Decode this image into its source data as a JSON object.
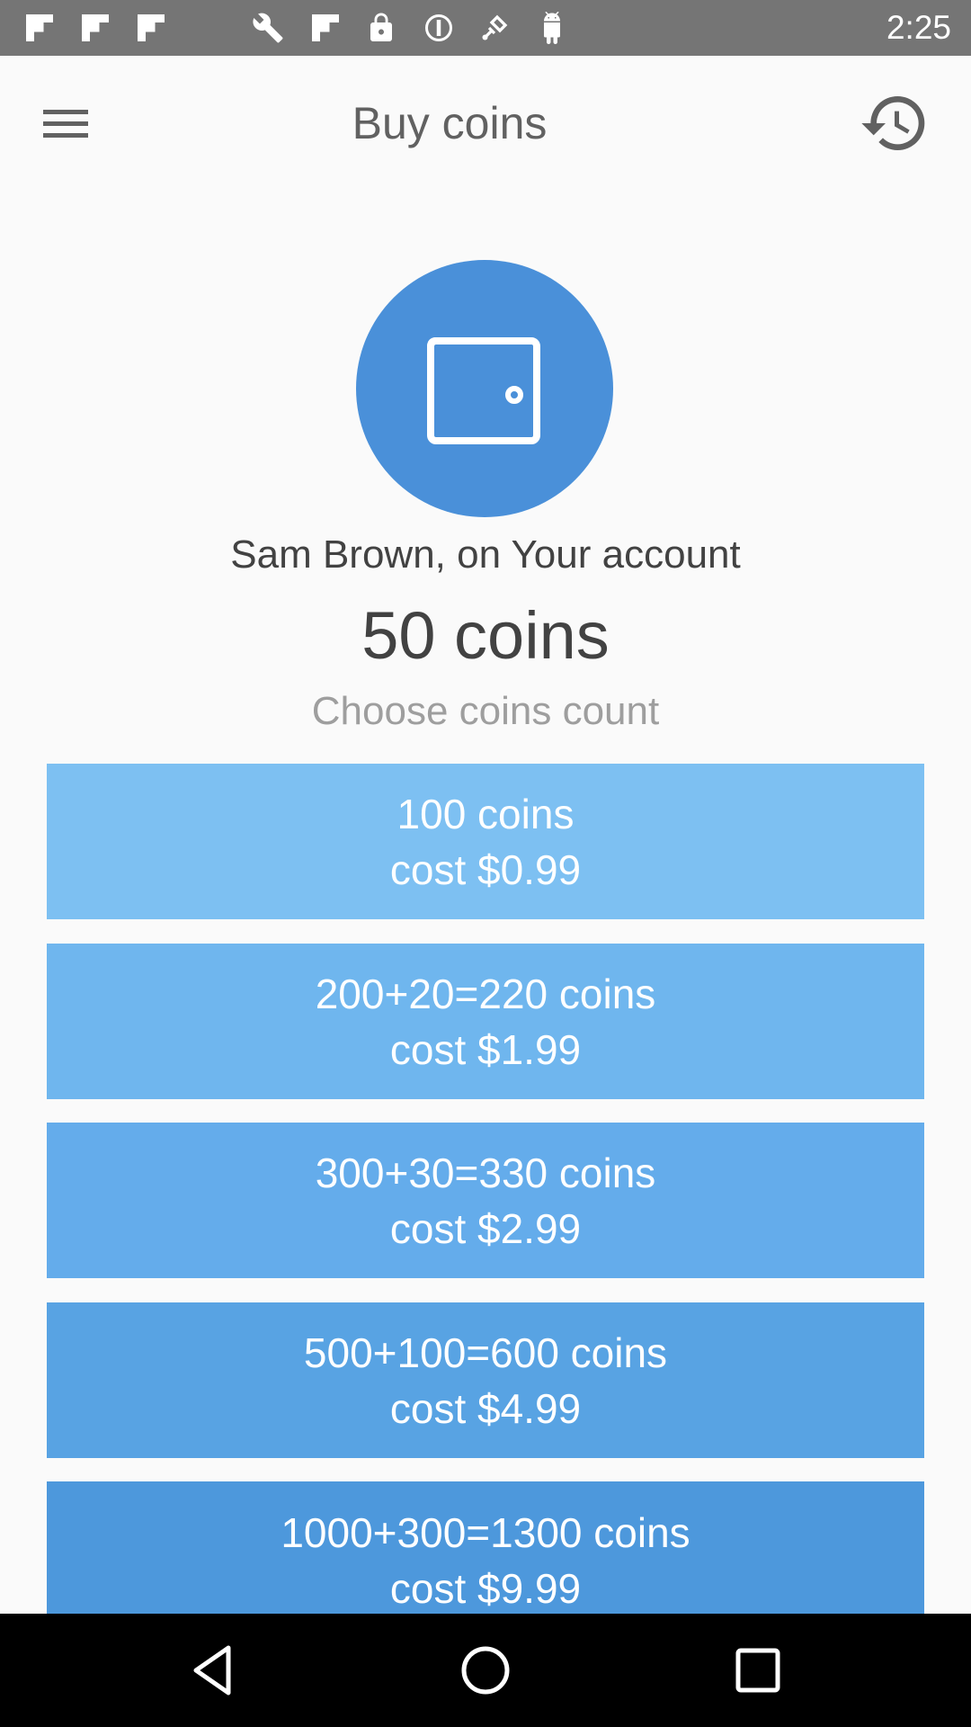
{
  "status_bar": {
    "time": "2:25",
    "icons": [
      "flipboard-icon",
      "flipboard-icon",
      "flipboard-icon",
      "wrench-icon",
      "flipboard-icon",
      "lock-icon",
      "sync-icon",
      "fake-gps-icon",
      "android-icon"
    ]
  },
  "app_bar": {
    "title": "Buy coins",
    "menu_icon": "menu-icon",
    "history_icon": "history-icon"
  },
  "account": {
    "wallet_icon": "wallet-icon",
    "line": "Sam Brown, on Your account",
    "balance": "50 coins",
    "choose_label": "Choose coins count"
  },
  "packages": [
    {
      "coins": "100 coins",
      "cost": "cost $0.99",
      "color": "#7dc0f2"
    },
    {
      "coins": "200+20=220 coins",
      "cost": "cost $1.99",
      "color": "#6fb6ee"
    },
    {
      "coins": "300+30=330 coins",
      "cost": "cost $2.99",
      "color": "#64aceb"
    },
    {
      "coins": "500+100=600 coins",
      "cost": "cost $4.99",
      "color": "#58a3e3"
    },
    {
      "coins": "1000+300=1300 coins",
      "cost": "cost $9.99",
      "color": "#4d98dc"
    }
  ],
  "nav_bar": {
    "back_icon": "back-icon",
    "home_icon": "home-icon",
    "recents_icon": "recents-icon"
  },
  "colors": {
    "status_bar": "#757575",
    "background": "#fafafa",
    "wallet_circle": "#4a90d9"
  }
}
